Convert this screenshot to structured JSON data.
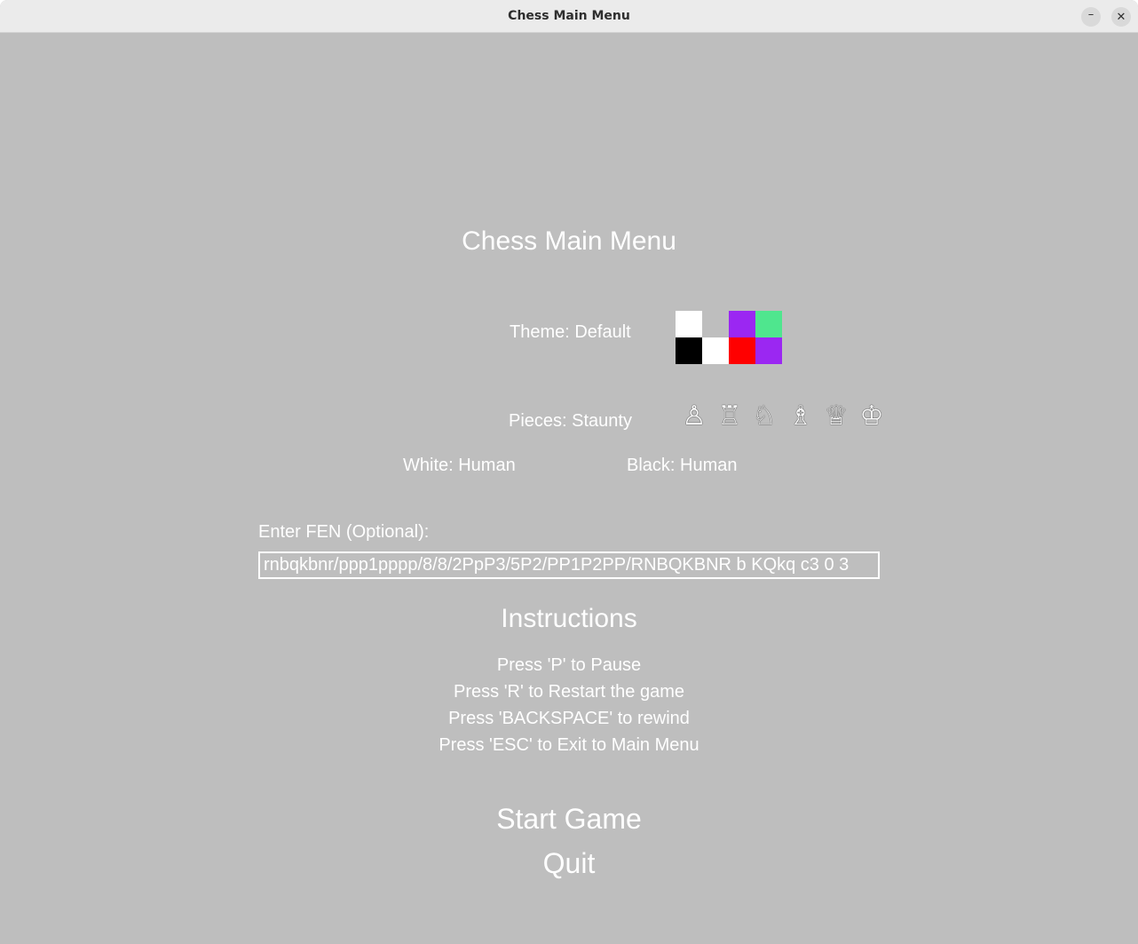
{
  "window": {
    "title": "Chess Main Menu",
    "minimize_glyph": "–",
    "close_glyph": "✕"
  },
  "menu": {
    "heading": "Chess Main Menu",
    "theme_label": "Theme: Default",
    "theme_colors": [
      "#ffffff",
      "#bebebe",
      "#9b27f2",
      "#4fe68e",
      "#000000",
      "#ffffff",
      "#ff0000",
      "#9b27f2"
    ],
    "pieces_label": "Pieces: Staunty",
    "pieces": [
      {
        "name": "pawn-icon",
        "glyph": "♙"
      },
      {
        "name": "rook-icon",
        "glyph": "♖"
      },
      {
        "name": "knight-icon",
        "glyph": "♘"
      },
      {
        "name": "bishop-icon",
        "glyph": "♗"
      },
      {
        "name": "queen-icon",
        "glyph": "♕"
      },
      {
        "name": "king-icon",
        "glyph": "♔"
      }
    ],
    "white_player": "White: Human",
    "black_player": "Black: Human",
    "fen_label": "Enter FEN (Optional):",
    "fen_value": "rnbqkbnr/ppp1pppp/8/8/2PpP3/5P2/PP1P2PP/RNBQKBNR b KQkq c3 0 3",
    "instructions_title": "Instructions",
    "instructions": [
      "Press 'P' to Pause",
      "Press 'R' to Restart the game",
      "Press 'BACKSPACE' to rewind",
      "Press 'ESC' to Exit to Main Menu"
    ],
    "start_label": "Start Game",
    "quit_label": "Quit"
  }
}
